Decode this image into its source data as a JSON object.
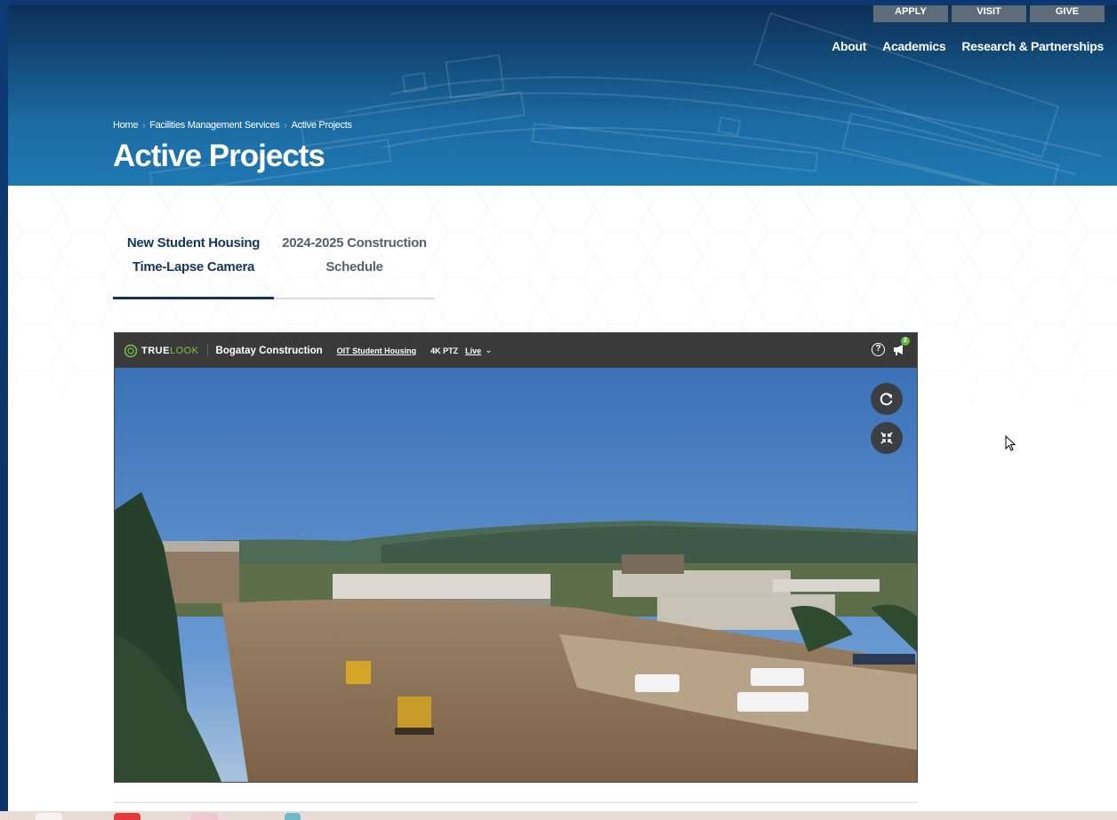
{
  "header": {
    "utility_nav": [
      "APPLY",
      "VISIT",
      "GIVE"
    ],
    "main_nav": [
      "About",
      "Academics",
      "Research & Partnerships"
    ],
    "breadcrumb": [
      "Home",
      "Facilities Management Services",
      "Active Projects"
    ],
    "title": "Active Projects"
  },
  "tabs": [
    {
      "line1": "New Student Housing",
      "line2": "Time-Lapse Camera",
      "active": true
    },
    {
      "line1": "2024-2025 Construction",
      "line2": "Schedule",
      "active": false
    }
  ],
  "camera": {
    "logo_main": "TRUE",
    "logo_accent": "LOOK",
    "company": "Bogatay Construction",
    "project_link": "OIT Student Housing",
    "camera_type": "4K PTZ",
    "view_mode": "Live",
    "notification_count": "2",
    "icons": [
      "help-icon",
      "announcement-icon",
      "refresh-icon",
      "exit-fullscreen-icon"
    ]
  },
  "colors": {
    "header_blue": "#1f78b2",
    "title_navy": "#14365e",
    "truelook_green": "#7bc143"
  }
}
